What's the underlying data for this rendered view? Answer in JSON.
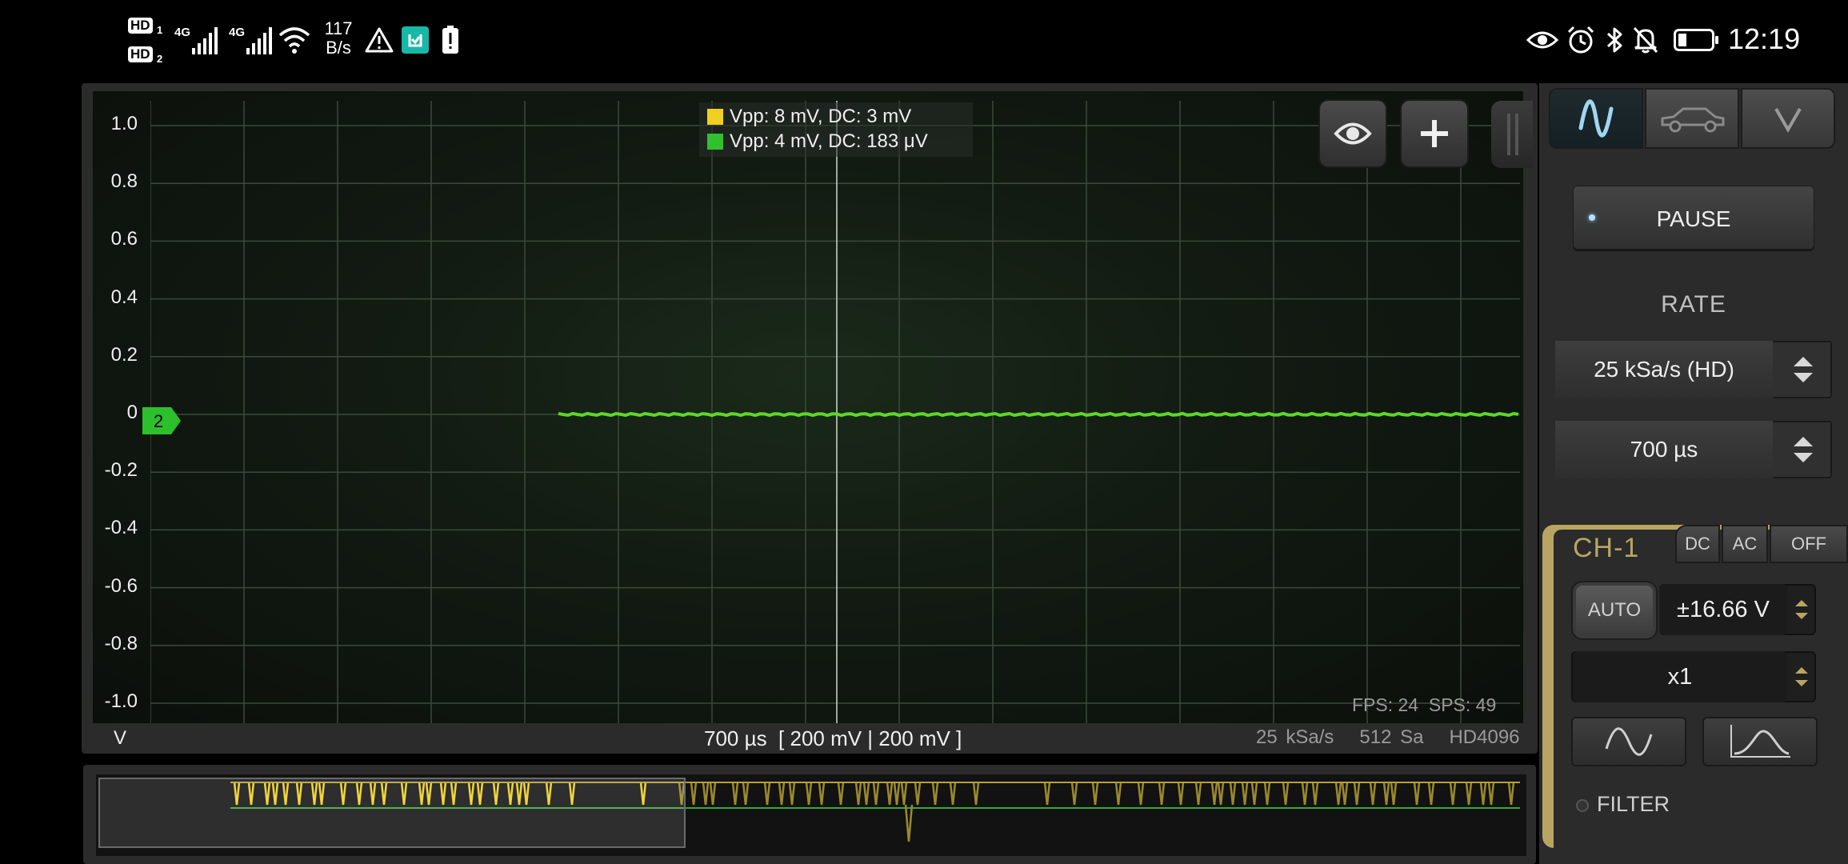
{
  "status_bar": {
    "sim1_badge": "HD",
    "sim1_index": "1",
    "sim2_badge": "HD",
    "sim2_index": "2",
    "net1": "4G",
    "net2": "4G",
    "speed_value": "117",
    "speed_unit": "B/s",
    "time": "12:19",
    "icons_left": [
      "signal-icon",
      "signal-icon",
      "wifi-icon",
      "warning-icon",
      "mi-app-icon",
      "battery-alert-icon"
    ],
    "icons_right": [
      "eye-icon",
      "alarm-icon",
      "bluetooth-icon",
      "bell-off-icon",
      "battery-icon"
    ]
  },
  "scope": {
    "y_labels": [
      "1.0",
      "0.8",
      "0.6",
      "0.4",
      "0.2",
      "0",
      "-0.2",
      "-0.4",
      "-0.6",
      "-0.8",
      "-1.0"
    ],
    "y_unit": "V",
    "ch2_marker": "2",
    "legend": [
      {
        "text": "Vpp: 8 mV, DC: 3 mV",
        "color": "#f0d020"
      },
      {
        "text": "Vpp: 4 mV, DC: 183 μV",
        "color": "#30c030"
      }
    ],
    "fps_text": "FPS: 24  SPS: 49",
    "bottom_center": "700 µs  [ 200 mV | 200 mV ]",
    "bottom_right": "25 kSa/s   512 Sa   HD4096",
    "trace_color": "#5fd62a",
    "ch1_color": "#f0d020"
  },
  "panel": {
    "tabs": [
      "sine-wave-icon",
      "car-icon",
      "chevron-down-icon"
    ],
    "pause_label": "PAUSE",
    "rate_label": "RATE",
    "rate_value": "25 kSa/s (HD)",
    "timebase_value": "700 µs",
    "ch1": {
      "title": "CH-1",
      "coupling": [
        "DC",
        "AC",
        "OFF"
      ],
      "auto_label": "AUTO",
      "range_value": "±16.66 V",
      "probe_value": "x1",
      "filter_label": "FILTER",
      "accent": "#b9a563"
    }
  }
}
